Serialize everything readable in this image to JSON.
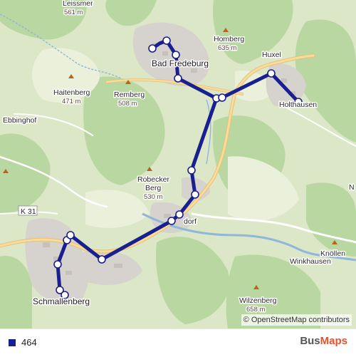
{
  "map": {
    "places": {
      "leissmer": "Leissmer",
      "leissmer_elev": "561 m",
      "bad_fredeburg": "Bad Fredeburg",
      "homberg": "Homberg",
      "homberg_elev": "635 m",
      "huxel": "Huxel",
      "holthausen": "Holthausen",
      "haitenberg": "Haitenberg",
      "haitenberg_elev": "471 m",
      "remberg": "Remberg",
      "remberg_elev": "508 m",
      "ebbinghof": "Ebbinghof",
      "robecker_berg_1": "Robecker",
      "robecker_berg_2": "Berg",
      "robecker_berg_elev": "530 m",
      "road_k31": "K 31",
      "dorf": "dorf",
      "schmallenberg": "Schmallenberg",
      "winkhausen": "Winkhausen",
      "knollen": "Knöllen",
      "wilzenberg": "Wilzenberg",
      "wilzenberg_elev": "658 m",
      "edge_n": "N"
    },
    "route_color": "#1a1f8f",
    "route_stops": [
      "stop-1",
      "stop-2",
      "stop-3",
      "stop-4",
      "stop-5",
      "stop-6",
      "stop-7",
      "stop-8",
      "stop-9",
      "stop-10",
      "stop-11",
      "stop-12",
      "stop-13",
      "stop-14",
      "stop-15",
      "stop-16",
      "stop-17",
      "stop-18"
    ],
    "attribution": "© OpenStreetMap contributors"
  },
  "legend": {
    "route_label": "464",
    "route_color": "#1a1f8f"
  },
  "brand": {
    "part1": "Bus",
    "part2": "Maps"
  }
}
